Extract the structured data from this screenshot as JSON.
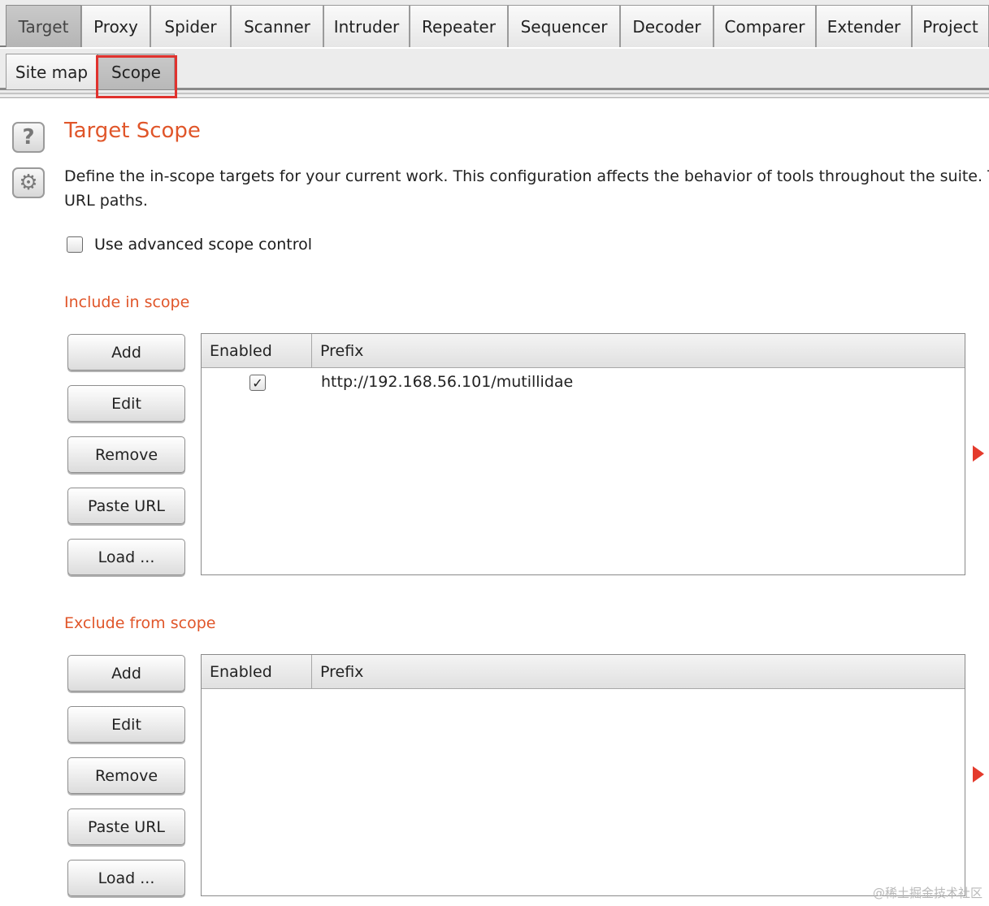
{
  "top_tabs": [
    "Target",
    "Proxy",
    "Spider",
    "Scanner",
    "Intruder",
    "Repeater",
    "Sequencer",
    "Decoder",
    "Comparer",
    "Extender",
    "Project"
  ],
  "sub_tabs": [
    "Site map",
    "Scope"
  ],
  "side_icons": {
    "help": "?",
    "settings": "⚙"
  },
  "page": {
    "title": "Target Scope",
    "description_line1": "Define the in-scope targets for your current work. This configuration affects the behavior of tools throughout the suite. T",
    "description_line2": "URL paths."
  },
  "advanced_scope": {
    "label": "Use advanced scope control",
    "checked": false
  },
  "include": {
    "title": "Include in scope",
    "buttons": [
      "Add",
      "Edit",
      "Remove",
      "Paste URL",
      "Load ..."
    ],
    "columns": [
      "Enabled",
      "Prefix"
    ],
    "rows": [
      {
        "enabled": true,
        "check": "✓",
        "prefix": "http://192.168.56.101/mutillidae"
      }
    ]
  },
  "exclude": {
    "title": "Exclude from scope",
    "buttons": [
      "Add",
      "Edit",
      "Remove",
      "Paste URL",
      "Load ..."
    ],
    "columns": [
      "Enabled",
      "Prefix"
    ],
    "rows": []
  },
  "watermark": "@稀土掘金技术社区",
  "colors": {
    "accent": "#e0562a",
    "highlight": "#e0322e",
    "arrow": "#e43a2c"
  }
}
